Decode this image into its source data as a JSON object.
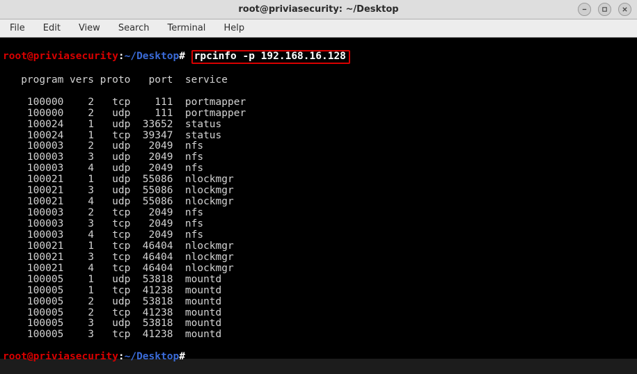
{
  "titlebar": {
    "title": "root@priviasecurity: ~/Desktop"
  },
  "window_controls": {
    "minimize": "minimize",
    "maximize": "maximize",
    "close": "close"
  },
  "menubar": {
    "file": "File",
    "edit": "Edit",
    "view": "View",
    "search": "Search",
    "terminal": "Terminal",
    "help": "Help"
  },
  "prompt": {
    "user_host": "root@priviasecurity",
    "colon": ":",
    "path": "~/Desktop",
    "hash": "#"
  },
  "command": "rpcinfo -p 192.168.16.128",
  "table": {
    "header": "   program vers proto   port  service",
    "rows": [
      "    100000    2   tcp    111  portmapper",
      "    100000    2   udp    111  portmapper",
      "    100024    1   udp  33652  status",
      "    100024    1   tcp  39347  status",
      "    100003    2   udp   2049  nfs",
      "    100003    3   udp   2049  nfs",
      "    100003    4   udp   2049  nfs",
      "    100021    1   udp  55086  nlockmgr",
      "    100021    3   udp  55086  nlockmgr",
      "    100021    4   udp  55086  nlockmgr",
      "    100003    2   tcp   2049  nfs",
      "    100003    3   tcp   2049  nfs",
      "    100003    4   tcp   2049  nfs",
      "    100021    1   tcp  46404  nlockmgr",
      "    100021    3   tcp  46404  nlockmgr",
      "    100021    4   tcp  46404  nlockmgr",
      "    100005    1   udp  53818  mountd",
      "    100005    1   tcp  41238  mountd",
      "    100005    2   udp  53818  mountd",
      "    100005    2   tcp  41238  mountd",
      "    100005    3   udp  53818  mountd",
      "    100005    3   tcp  41238  mountd"
    ]
  },
  "chart_data": {
    "type": "table",
    "title": "rpcinfo -p output",
    "columns": [
      "program",
      "vers",
      "proto",
      "port",
      "service"
    ],
    "rows": [
      [
        100000,
        2,
        "tcp",
        111,
        "portmapper"
      ],
      [
        100000,
        2,
        "udp",
        111,
        "portmapper"
      ],
      [
        100024,
        1,
        "udp",
        33652,
        "status"
      ],
      [
        100024,
        1,
        "tcp",
        39347,
        "status"
      ],
      [
        100003,
        2,
        "udp",
        2049,
        "nfs"
      ],
      [
        100003,
        3,
        "udp",
        2049,
        "nfs"
      ],
      [
        100003,
        4,
        "udp",
        2049,
        "nfs"
      ],
      [
        100021,
        1,
        "udp",
        55086,
        "nlockmgr"
      ],
      [
        100021,
        3,
        "udp",
        55086,
        "nlockmgr"
      ],
      [
        100021,
        4,
        "udp",
        55086,
        "nlockmgr"
      ],
      [
        100003,
        2,
        "tcp",
        2049,
        "nfs"
      ],
      [
        100003,
        3,
        "tcp",
        2049,
        "nfs"
      ],
      [
        100003,
        4,
        "tcp",
        2049,
        "nfs"
      ],
      [
        100021,
        1,
        "tcp",
        46404,
        "nlockmgr"
      ],
      [
        100021,
        3,
        "tcp",
        46404,
        "nlockmgr"
      ],
      [
        100021,
        4,
        "tcp",
        46404,
        "nlockmgr"
      ],
      [
        100005,
        1,
        "udp",
        53818,
        "mountd"
      ],
      [
        100005,
        1,
        "tcp",
        41238,
        "mountd"
      ],
      [
        100005,
        2,
        "udp",
        53818,
        "mountd"
      ],
      [
        100005,
        2,
        "tcp",
        41238,
        "mountd"
      ],
      [
        100005,
        3,
        "udp",
        53818,
        "mountd"
      ],
      [
        100005,
        3,
        "tcp",
        41238,
        "mountd"
      ]
    ]
  }
}
